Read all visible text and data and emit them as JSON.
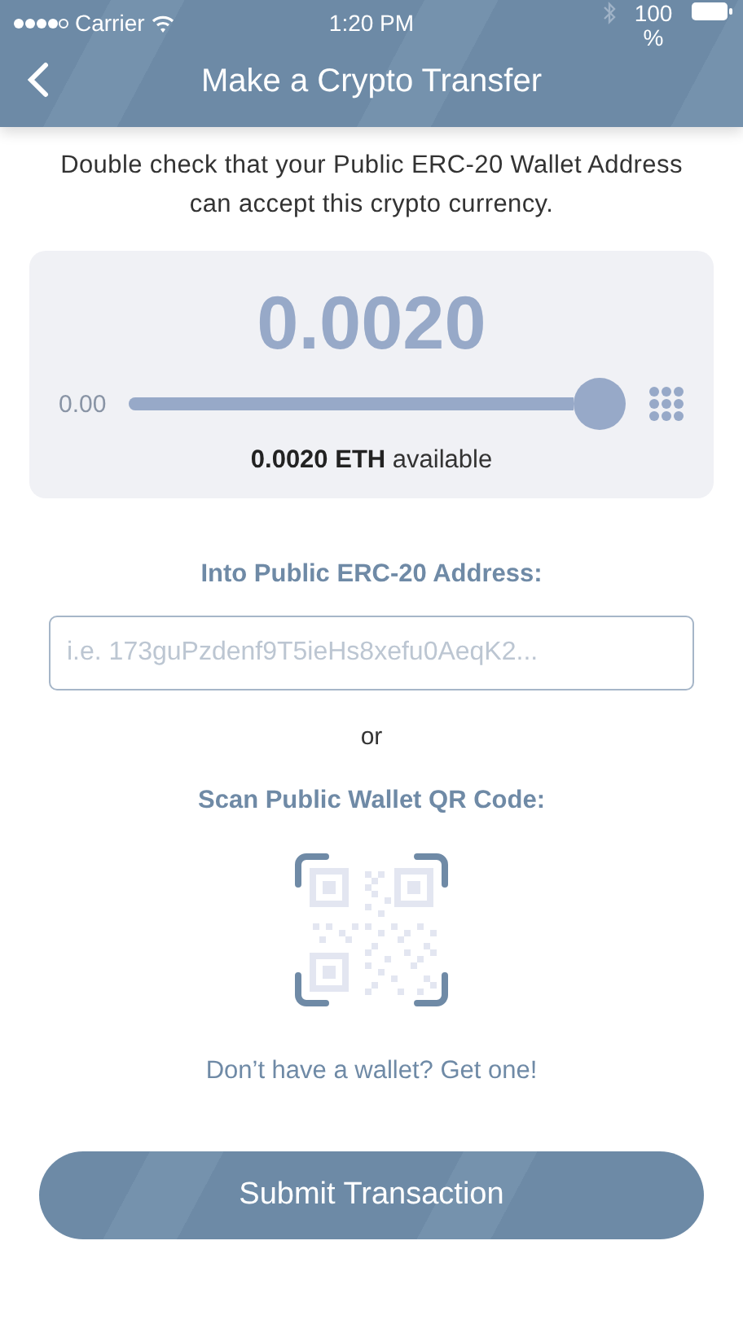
{
  "status_bar": {
    "carrier": "Carrier",
    "time": "1:20 PM",
    "battery": "100 %"
  },
  "header": {
    "title": "Make a Crypto Transfer"
  },
  "notice": "Double check that your Public ERC-20 Wallet Address can accept this crypto currency.",
  "amount_card": {
    "amount": "0.0020",
    "min_label": "0.00",
    "slider": {
      "level": 1
    },
    "available": "**0.0020 ETH** available"
  },
  "address": {
    "label": "Into Public ERC-20 Address:",
    "placeholder": "i.e. 173guPzdenf9T5ieHs8xefu0AeqK2..."
  },
  "separator": "or",
  "scan": {
    "label": "Scan Public Wallet QR Code:"
  },
  "get_wallet_link": "Don’t have a wallet? Get one!",
  "submit_button": "Submit Transaction"
}
